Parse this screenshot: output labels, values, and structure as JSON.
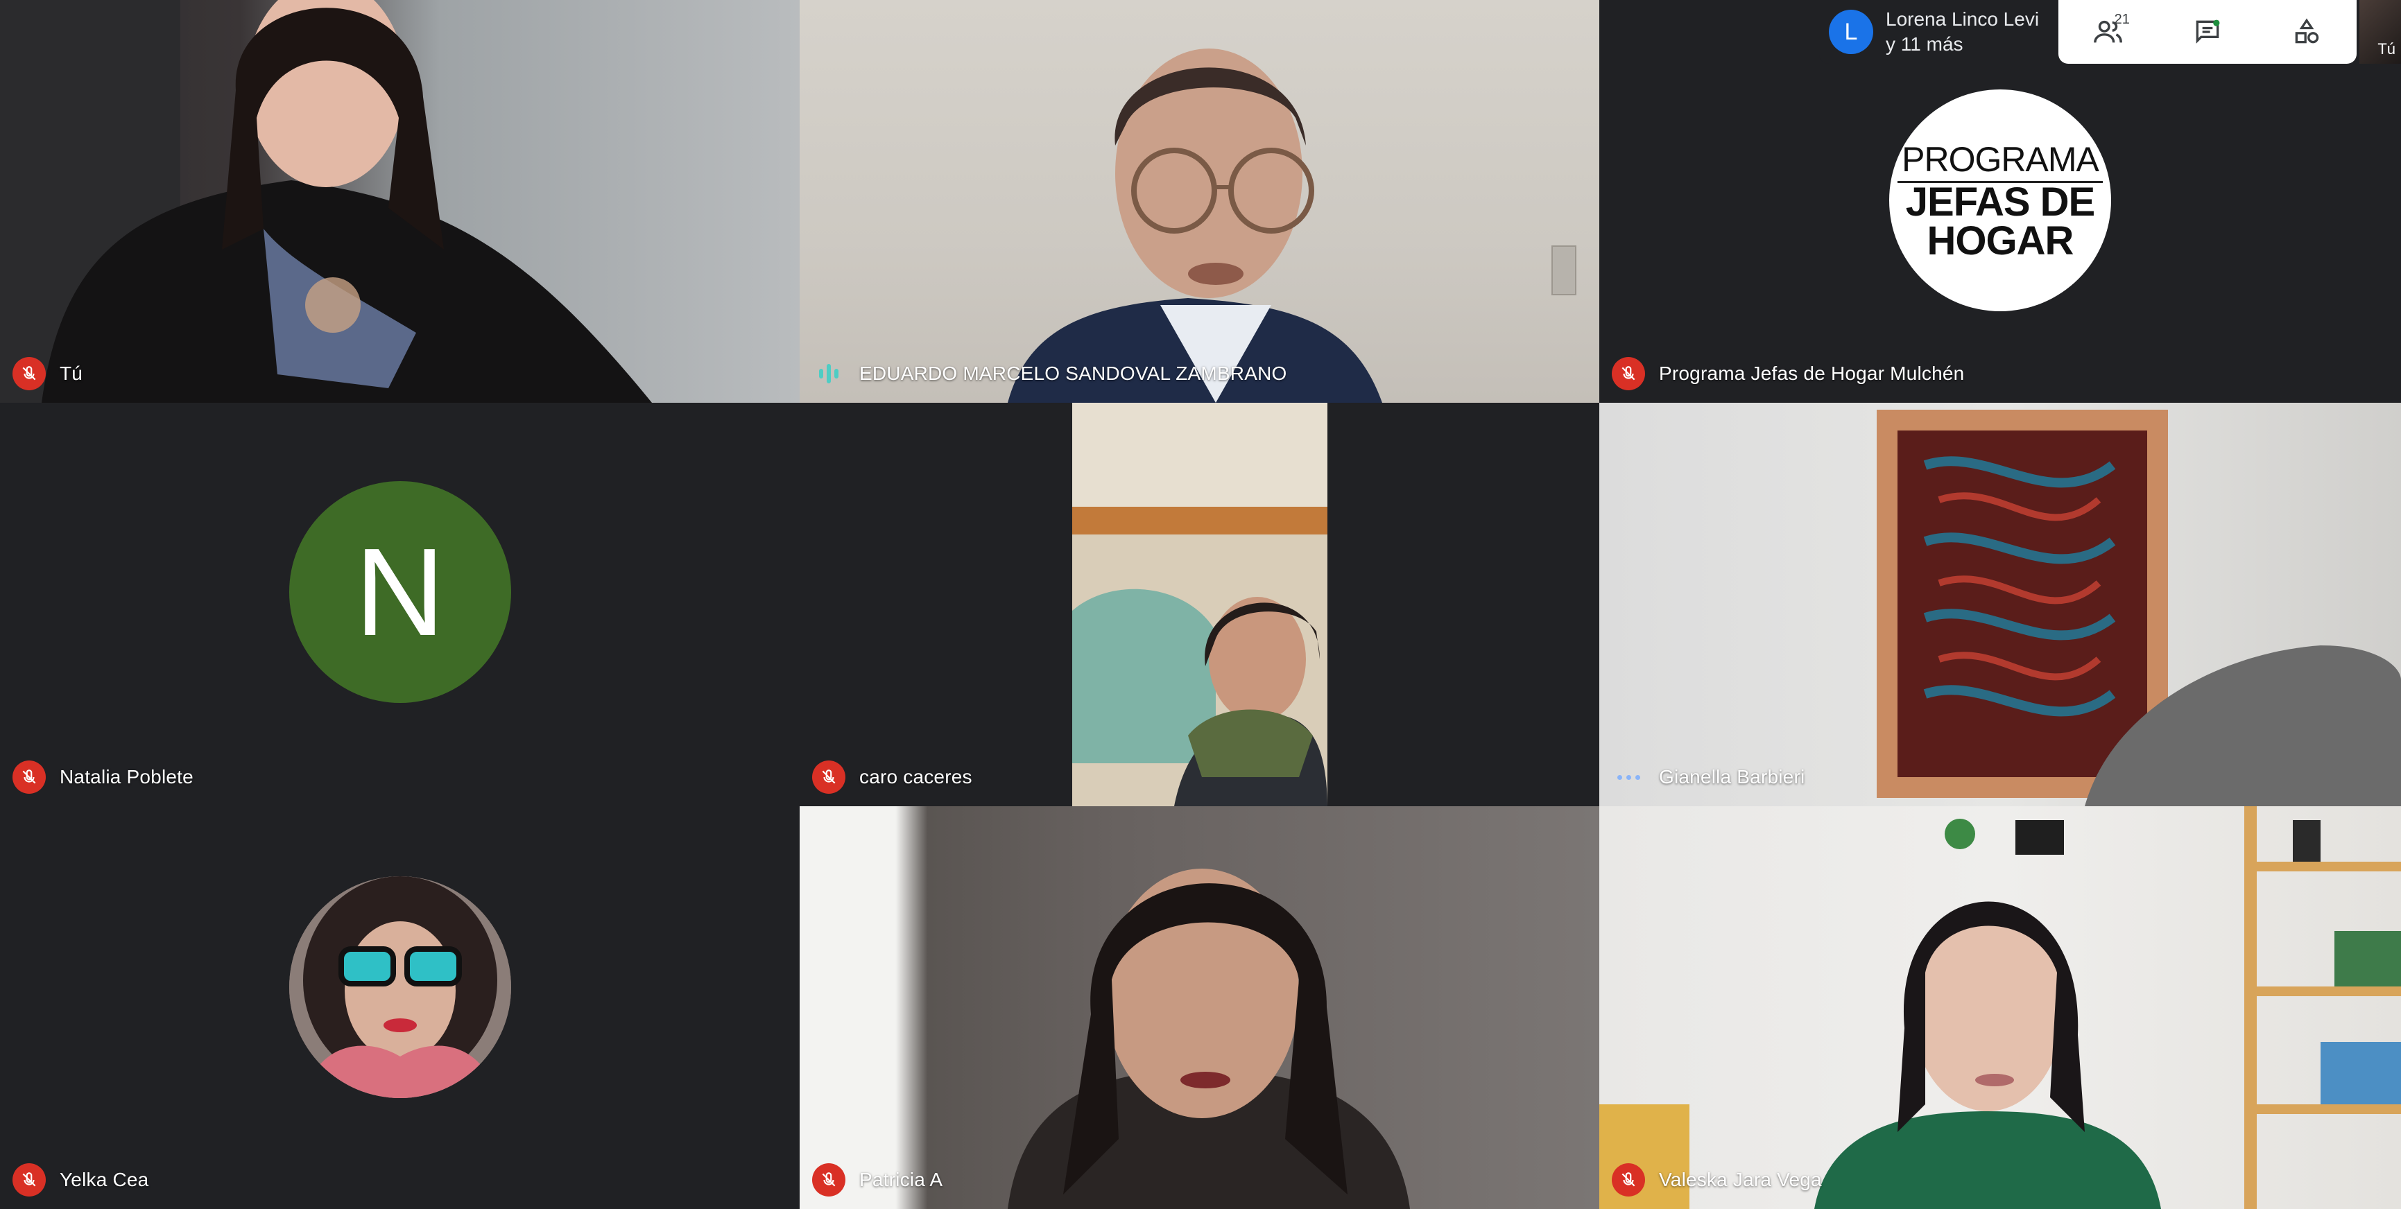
{
  "presenter": {
    "initial": "L",
    "line1": "Lorena Linco Levi",
    "line2": "y 11 más"
  },
  "controls": {
    "people_count": "21"
  },
  "self_view_label": "Tú",
  "tiles": [
    {
      "name": "Tú",
      "status": "muted"
    },
    {
      "name": "EDUARDO MARCELO SANDOVAL ZAMBRANO",
      "status": "speaking"
    },
    {
      "name": "Programa Jefas de Hogar Mulchén",
      "status": "muted",
      "logo": {
        "line1": "PROGRAMA",
        "line2": "JEFAS DE",
        "line3": "HOGAR"
      }
    },
    {
      "name": "Natalia Poblete",
      "status": "muted",
      "avatar_initial": "N"
    },
    {
      "name": "caro caceres",
      "status": "muted"
    },
    {
      "name": "Gianella Barbieri",
      "status": "idle"
    },
    {
      "name": "Yelka Cea",
      "status": "muted"
    },
    {
      "name": "Patricia A",
      "status": "muted"
    },
    {
      "name": "Valeska Jara Vega",
      "status": "muted"
    }
  ],
  "colors": {
    "background": "#202124",
    "muted": "#d93025",
    "speaking": "#4ecdc4",
    "avatar_green": "#3e6b26",
    "presenter_avatar": "#1a73e8"
  }
}
